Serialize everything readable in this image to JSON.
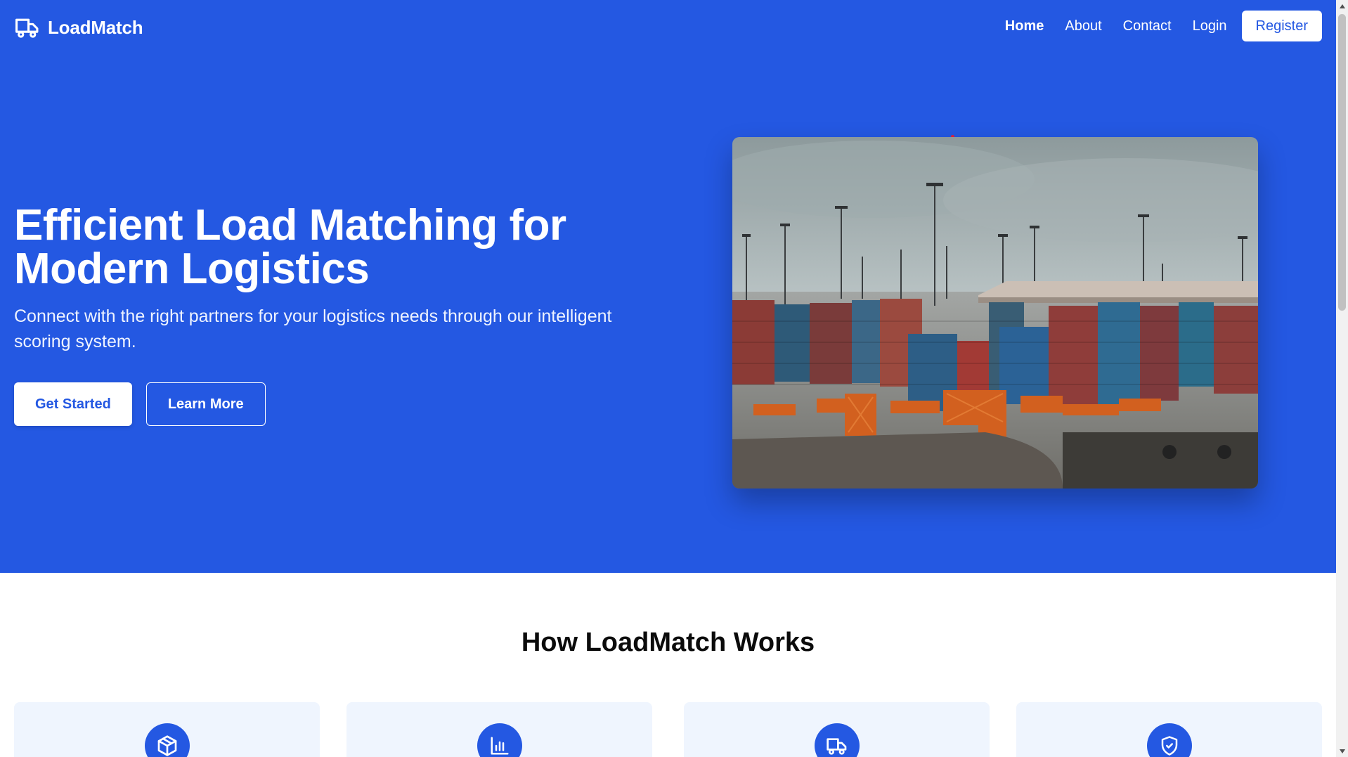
{
  "brand": {
    "name": "LoadMatch",
    "icon": "truck-icon"
  },
  "nav": {
    "links": [
      {
        "label": "Home",
        "active": true
      },
      {
        "label": "About",
        "active": false
      },
      {
        "label": "Contact",
        "active": false
      },
      {
        "label": "Login",
        "active": false
      }
    ],
    "register_label": "Register"
  },
  "hero": {
    "title_line1": "Efficient Load Matching for",
    "title_line2": "Modern Logistics",
    "subtitle": "Connect with the right partners for your logistics needs through our intelligent scoring system.",
    "primary_button": "Get Started",
    "secondary_button": "Learn More",
    "image_subject": "container-port-photo"
  },
  "how_it_works": {
    "title": "How LoadMatch Works",
    "cards": [
      {
        "icon": "package-icon"
      },
      {
        "icon": "bar-chart-icon"
      },
      {
        "icon": "truck-icon"
      },
      {
        "icon": "shield-check-icon"
      }
    ]
  },
  "colors": {
    "brand_blue": "#2458e2",
    "card_bg": "#eff5fe",
    "white": "#ffffff"
  }
}
